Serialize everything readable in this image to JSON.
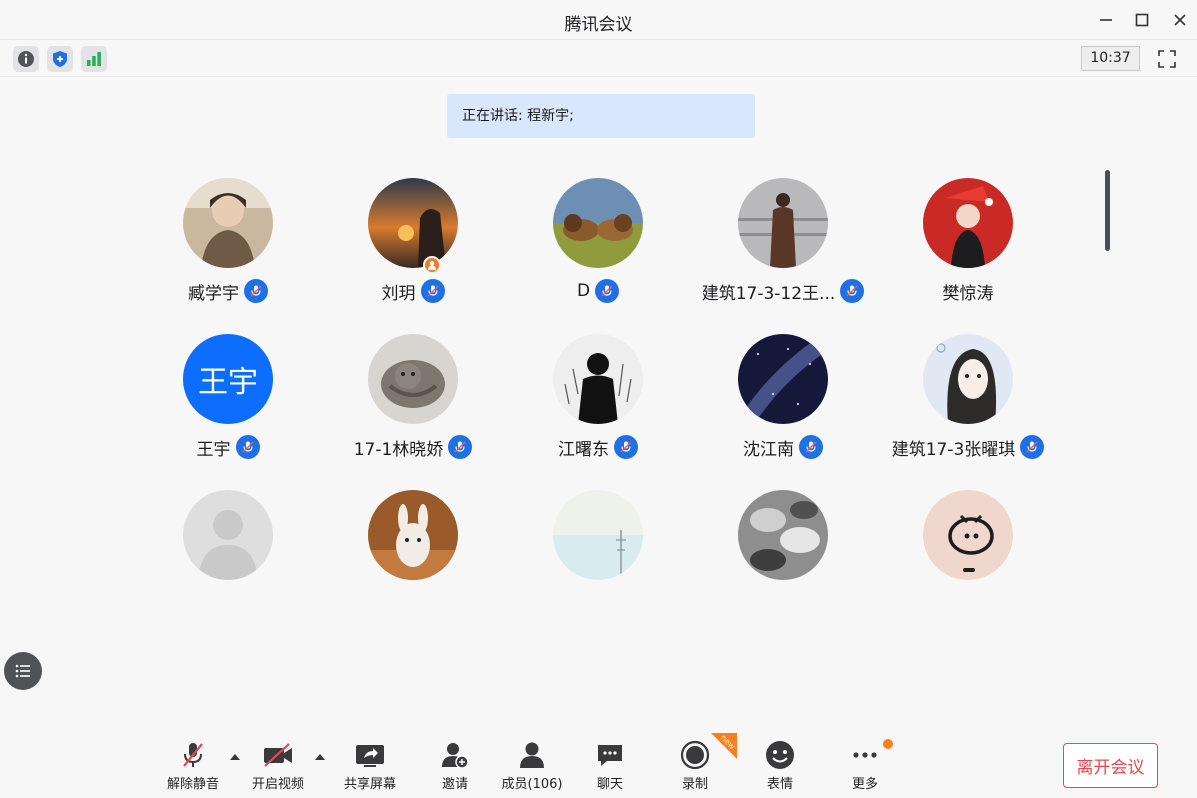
{
  "window": {
    "title": "腾讯会议"
  },
  "toolbar": {
    "clock": "10:37"
  },
  "banner": {
    "speaking": "正在讲话: 程新宇;"
  },
  "participants": [
    {
      "name": "臧学宇",
      "muted": true
    },
    {
      "name": "刘玥",
      "muted": true,
      "host": true
    },
    {
      "name": "D",
      "muted": true
    },
    {
      "name": "建筑17-3-12王...",
      "muted": true
    },
    {
      "name": "樊惊涛",
      "muted": false
    },
    {
      "name": "王宇",
      "muted": true,
      "avatar_text": "王宇"
    },
    {
      "name": "17-1林晓娇",
      "muted": true
    },
    {
      "name": "江曙东",
      "muted": true
    },
    {
      "name": "沈江南",
      "muted": true
    },
    {
      "name": "建筑17-3张曜琪",
      "muted": true
    }
  ],
  "bottom_bar": {
    "mute": "解除静音",
    "video": "开启视频",
    "share": "共享屏幕",
    "invite": "邀请",
    "members": "成员(106)",
    "chat": "聊天",
    "record": "录制",
    "record_tag": "new",
    "reactions": "表情",
    "more": "更多",
    "leave": "离开会议"
  },
  "colors": {
    "accent_blue": "#1f6fe5",
    "leave_red": "#e5484d",
    "banner_bg": "#d8e7fb",
    "host_orange": "#f57c22"
  }
}
